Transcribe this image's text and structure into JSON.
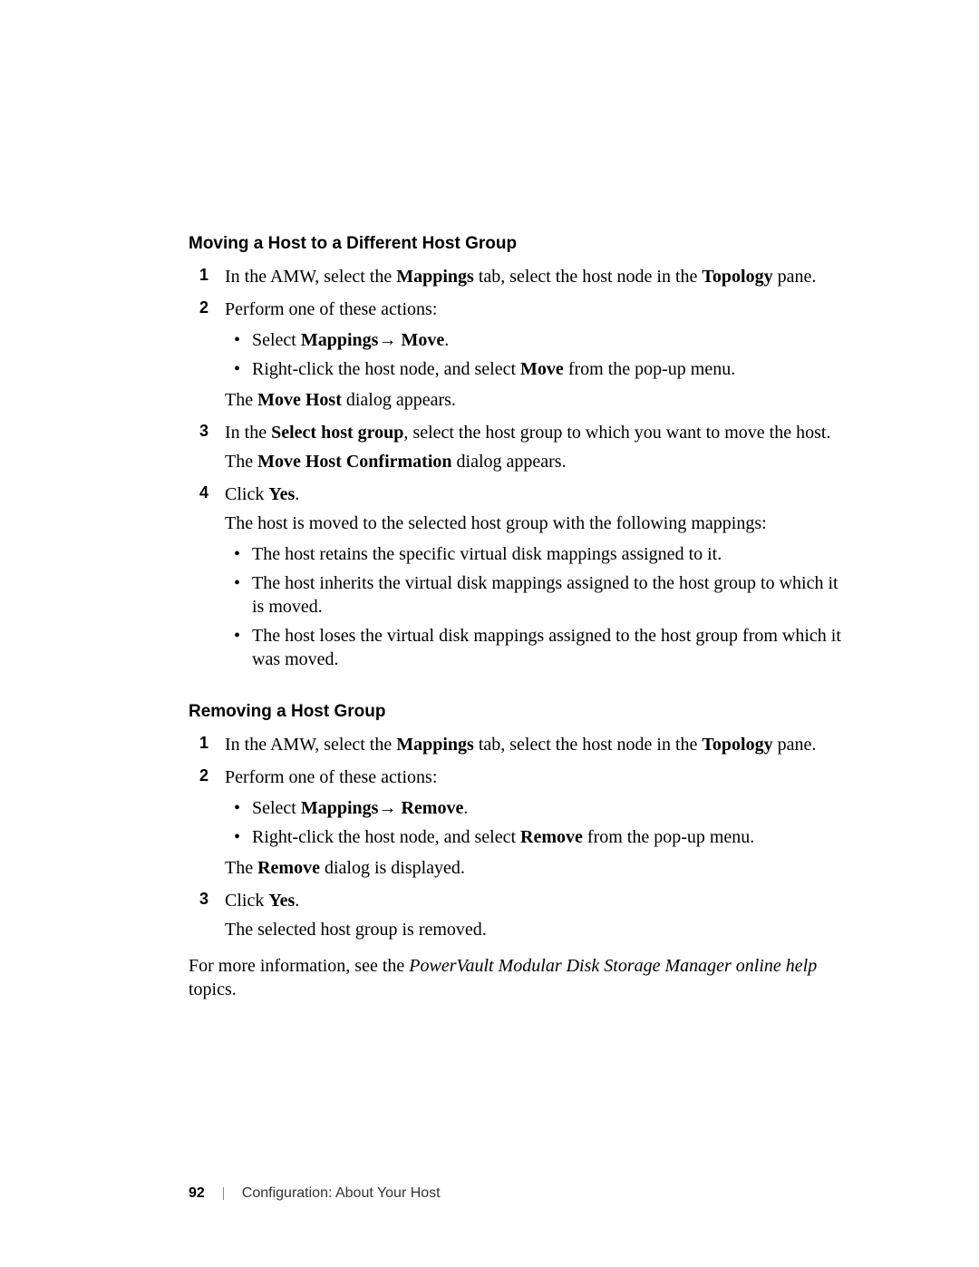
{
  "section1": {
    "heading": "Moving a Host to a Different Host Group",
    "steps": [
      {
        "num": "1",
        "pre": "In the AMW, select the ",
        "bold1": "Mappings",
        "mid": " tab, select the host node in the ",
        "bold2": "Topology",
        "post": " pane."
      },
      {
        "num": "2",
        "text": "Perform one of these actions:",
        "bullets": [
          {
            "pre": "Select ",
            "bold": "Mappings→ Move",
            "post": "."
          },
          {
            "pre": "Right-click the host node, and select ",
            "bold": "Move",
            "post": " from the pop-up menu."
          }
        ],
        "after_pre": "The ",
        "after_bold": "Move Host",
        "after_post": " dialog appears."
      },
      {
        "num": "3",
        "pre": "In the ",
        "bold1": "Select host group",
        "post1": ", select the host group to which you want to move the host.",
        "after_pre": "The ",
        "after_bold": "Move Host Confirmation",
        "after_post": " dialog appears."
      },
      {
        "num": "4",
        "pre": "Click ",
        "bold1": "Yes",
        "post1": ".",
        "after_text": "The host is moved to the selected host group with the following mappings:",
        "bullets": [
          {
            "text": "The host retains the specific virtual disk mappings assigned to it."
          },
          {
            "text": "The host inherits the virtual disk mappings assigned to the host group to which it is moved."
          },
          {
            "text": "The host loses the virtual disk mappings assigned to the host group from which it was moved."
          }
        ]
      }
    ]
  },
  "section2": {
    "heading": "Removing a Host Group",
    "steps": [
      {
        "num": "1",
        "pre": "In the AMW, select the ",
        "bold1": "Mappings",
        "mid": " tab, select the host node in the ",
        "bold2": "Topology",
        "post": " pane."
      },
      {
        "num": "2",
        "text": "Perform one of these actions:",
        "bullets": [
          {
            "pre": "Select ",
            "bold": "Mappings→ Remove",
            "post": "."
          },
          {
            "pre": "Right-click the host node, and select ",
            "bold": "Remove",
            "post": " from the pop-up menu."
          }
        ],
        "after_pre": "The ",
        "after_bold": "Remove",
        "after_post": " dialog is displayed."
      },
      {
        "num": "3",
        "pre": "Click ",
        "bold1": "Yes",
        "post1": ".",
        "after_text": "The selected host group is removed."
      }
    ],
    "closing_pre": "For more information, see the ",
    "closing_italic": "PowerVault Modular Disk Storage Manager online help",
    "closing_post": " topics."
  },
  "footer": {
    "page": "92",
    "chapter": "Configuration: About Your Host"
  }
}
